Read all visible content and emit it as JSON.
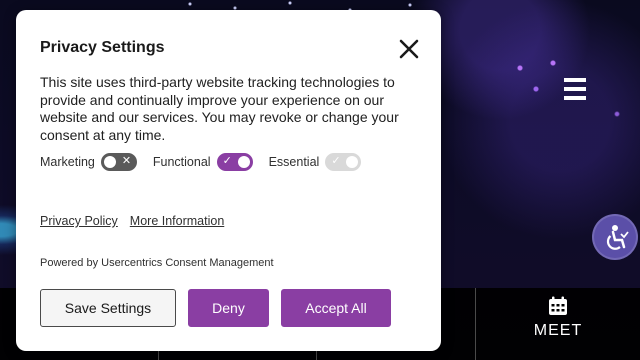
{
  "dialog": {
    "title": "Privacy Settings",
    "description": "This site uses third-party website tracking technologies to provide and continually improve your experience on our website and our services. You may revoke or change your consent at any time.",
    "toggles": [
      {
        "label": "Marketing",
        "state": "off"
      },
      {
        "label": "Functional",
        "state": "on"
      },
      {
        "label": "Essential",
        "state": "on-disabled"
      }
    ],
    "links": {
      "privacy_policy": "Privacy Policy",
      "more_information": "More Information"
    },
    "powered_by": "Powered by Usercentrics Consent Management",
    "buttons": {
      "save": "Save Settings",
      "deny": "Deny",
      "accept": "Accept All"
    }
  },
  "background": {
    "nav_item": "MEET",
    "icons": {
      "menu": "hamburger-icon",
      "accessibility": "accessibility-icon",
      "meet": "calendar-icon"
    }
  },
  "colors": {
    "accent": "#8a3ea3",
    "toggle_off": "#5a5a5a",
    "toggle_disabled": "#d9d9d9",
    "accessibility_button": "#5b4fa8"
  }
}
